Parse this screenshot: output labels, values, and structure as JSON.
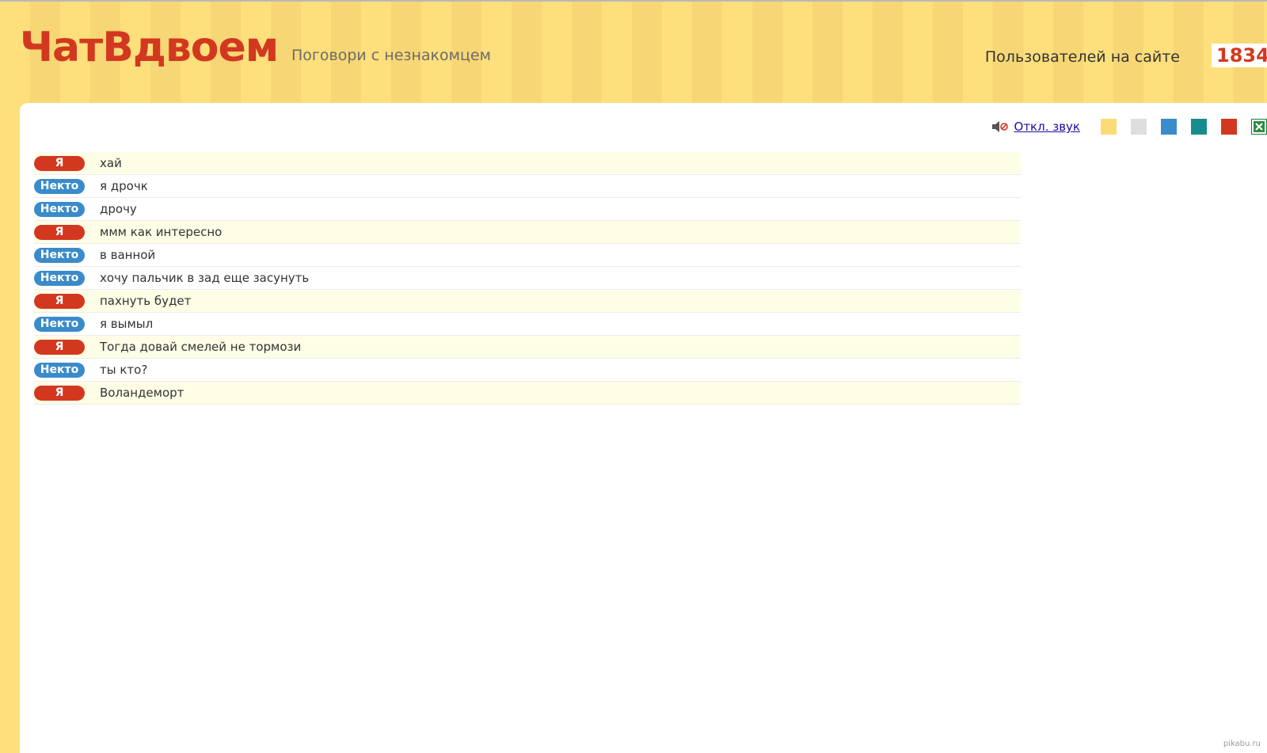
{
  "header": {
    "logo": "ЧатВдвоем",
    "tagline": "Поговори с незнакомцем",
    "users_label": "Пользователей на сайте",
    "users_count": "1834"
  },
  "toolbar": {
    "sound_icon": "speaker-muted-icon",
    "sound_label": "Откл. звук",
    "themes": [
      {
        "name": "yellow",
        "color": "#fbdb73"
      },
      {
        "name": "gray",
        "color": "#dedede"
      },
      {
        "name": "blue",
        "color": "#3a8bc9"
      },
      {
        "name": "teal",
        "color": "#188c8c"
      },
      {
        "name": "red",
        "color": "#d2381f"
      }
    ],
    "export_icon": "excel-icon"
  },
  "messages": [
    {
      "author": "Я",
      "from_me": true,
      "text": "хай"
    },
    {
      "author": "Некто",
      "from_me": false,
      "text": "я дрочк"
    },
    {
      "author": "Некто",
      "from_me": false,
      "text": "дрочу"
    },
    {
      "author": "Я",
      "from_me": true,
      "text": "ммм как интересно"
    },
    {
      "author": "Некто",
      "from_me": false,
      "text": "в ванной"
    },
    {
      "author": "Некто",
      "from_me": false,
      "text": "хочу пальчик в зад еще засунуть"
    },
    {
      "author": "Я",
      "from_me": true,
      "text": "пахнуть будет"
    },
    {
      "author": "Некто",
      "from_me": false,
      "text": "я вымыл"
    },
    {
      "author": "Я",
      "from_me": true,
      "text": "Тогда довай смелей не тормози"
    },
    {
      "author": "Некто",
      "from_me": false,
      "text": "ты кто?"
    },
    {
      "author": "Я",
      "from_me": true,
      "text": "Воландеморт"
    }
  ],
  "watermark": "pikabu.ru"
}
